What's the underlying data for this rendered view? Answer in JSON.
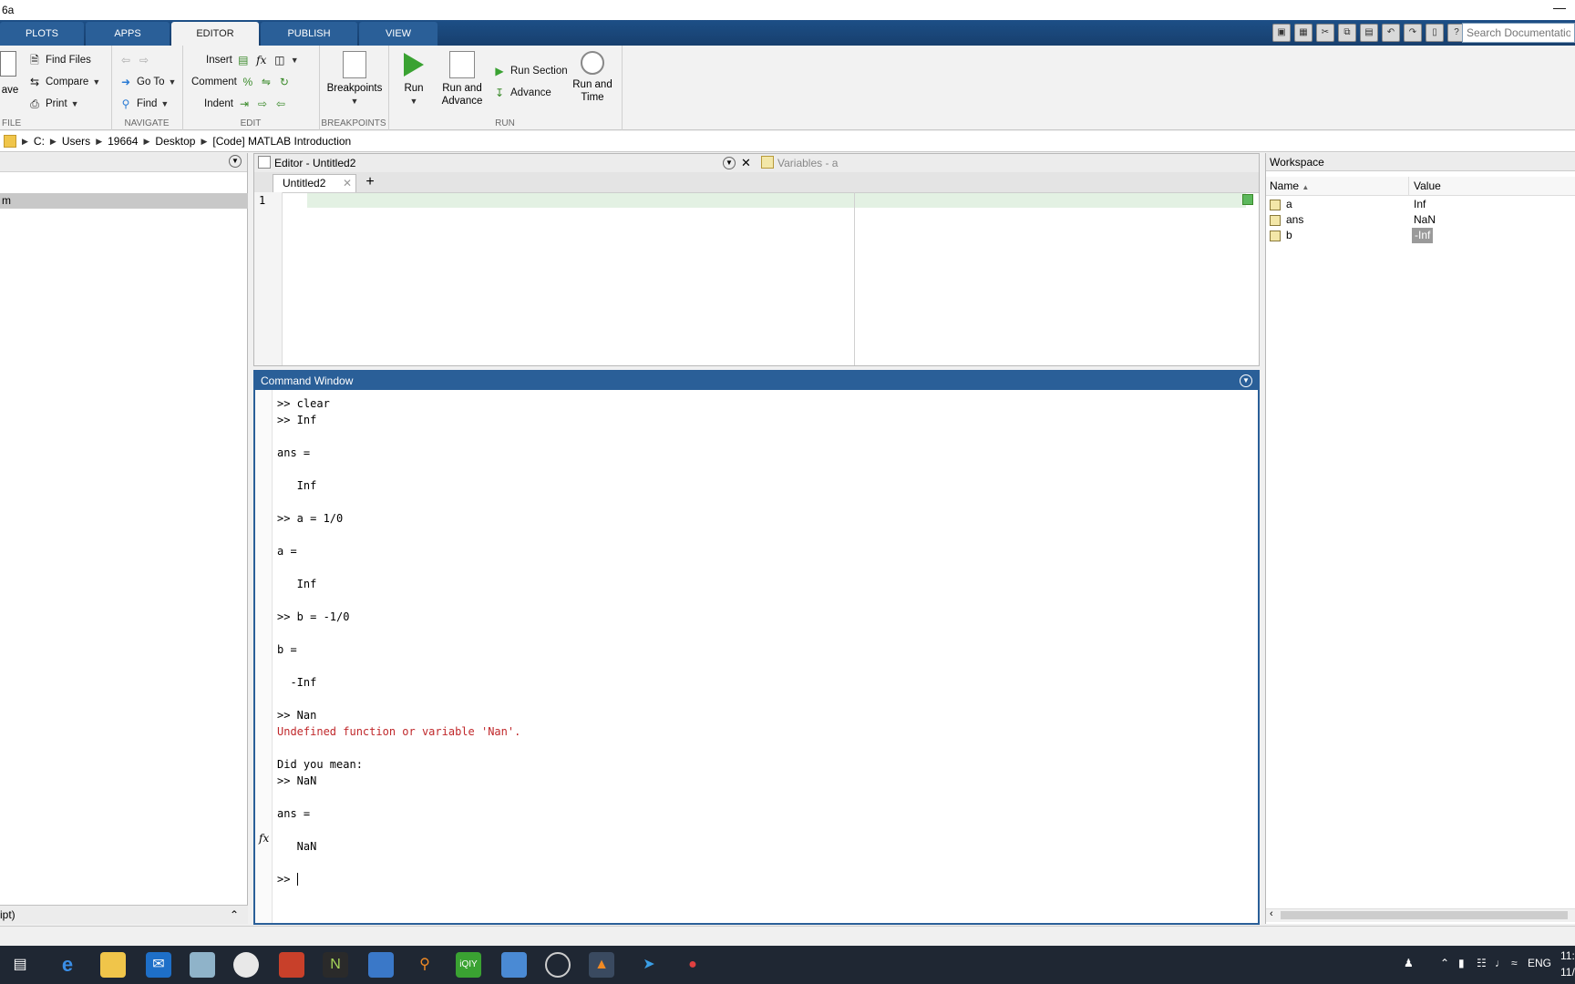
{
  "window": {
    "title": "6a"
  },
  "tabs": [
    {
      "label": "PLOTS"
    },
    {
      "label": "APPS"
    },
    {
      "label": "EDITOR"
    },
    {
      "label": "PUBLISH"
    },
    {
      "label": "VIEW"
    }
  ],
  "search": {
    "placeholder": "Search Documentation"
  },
  "ribbon": {
    "file": {
      "label": "FILE",
      "save": "ave",
      "find_files": "Find Files",
      "compare": "Compare",
      "print": "Print"
    },
    "navigate": {
      "label": "NAVIGATE",
      "go_to": "Go To",
      "find": "Find"
    },
    "edit": {
      "label": "EDIT",
      "insert": "Insert",
      "comment": "Comment",
      "indent": "Indent"
    },
    "breakpoints": {
      "label": "BREAKPOINTS",
      "button": "Breakpoints"
    },
    "run": {
      "label": "RUN",
      "run": "Run",
      "run_and_advance_1": "Run and",
      "run_and_advance_2": "Advance",
      "run_section": "Run Section",
      "advance": "Advance",
      "run_and_time_1": "Run and",
      "run_and_time_2": "Time"
    }
  },
  "address": {
    "crumbs": [
      "C:",
      "Users",
      "19664",
      "Desktop",
      "[Code] MATLAB Introduction"
    ]
  },
  "left_panel": {
    "selected_item": "m",
    "footer": "ipt)"
  },
  "editor": {
    "title": "Editor - Untitled2",
    "variables_tab": "Variables - a",
    "file_tab": "Untitled2",
    "line_number": "1"
  },
  "command_window": {
    "title": "Command Window",
    "lines": [
      ">> clear",
      ">> Inf",
      "",
      "ans =",
      "",
      "   Inf",
      "",
      ">> a = 1/0",
      "",
      "a =",
      "",
      "   Inf",
      "",
      ">> b = -1/0",
      "",
      "b =",
      "",
      "  -Inf",
      "",
      ">> Nan"
    ],
    "error_line": "Undefined function or variable 'Nan'.",
    "after_lines": [
      "",
      "Did you mean:",
      ">> NaN",
      "",
      "ans =",
      "",
      "   NaN",
      ""
    ],
    "prompt": ">> ",
    "fx_label": "fx"
  },
  "workspace": {
    "title": "Workspace",
    "columns": {
      "name": "Name",
      "value": "Value"
    },
    "rows": [
      {
        "name": "a",
        "value": "Inf"
      },
      {
        "name": "ans",
        "value": "NaN"
      },
      {
        "name": "b",
        "value": "-Inf"
      }
    ]
  },
  "tray": {
    "lang": "ENG",
    "time": "11:",
    "date": "11/"
  },
  "colors": {
    "accent": "#2a5f98",
    "error": "#c0282b",
    "ribbon_bg": "#f2f2f2"
  }
}
